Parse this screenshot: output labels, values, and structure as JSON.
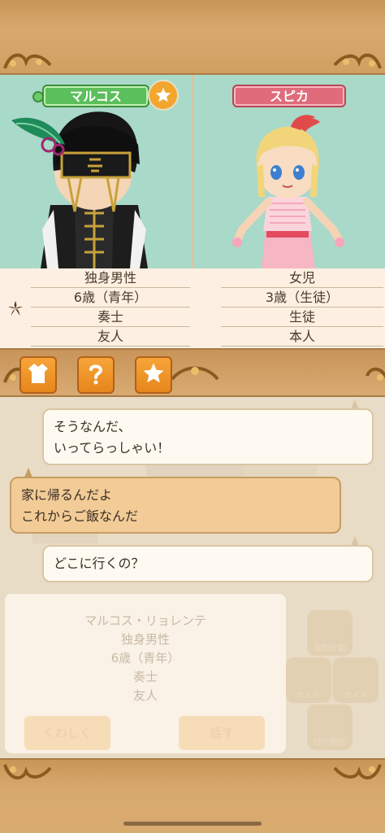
{
  "characters": {
    "left": {
      "name": "マルコス",
      "info": [
        "独身男性",
        "6歳（青年）",
        "奏士",
        "友人"
      ]
    },
    "right": {
      "name": "スピカ",
      "info": [
        "女児",
        "3歳（生徒）",
        "生徒",
        "本人"
      ]
    }
  },
  "toolbar": {
    "icons": [
      "clothes-icon",
      "question-icon",
      "star-icon"
    ]
  },
  "chat": [
    {
      "side": "right",
      "lines": [
        "そうなんだ、",
        "いってらっしゃい！"
      ]
    },
    {
      "side": "left",
      "lines": [
        "家に帰るんだよ",
        "これからご飯なんだ"
      ]
    },
    {
      "side": "right",
      "lines": [
        "どこに行くの？"
      ]
    }
  ],
  "background_card": {
    "full_name": "マルコス・リョレンテ",
    "info": [
      "独身男性",
      "6歳（青年）",
      "奏士",
      "友人"
    ],
    "details_button": "くわしく",
    "talk_button": "話す"
  },
  "side_menu": [
    "自動行動",
    "かんり",
    "ガイド",
    "日付関係"
  ],
  "colors": {
    "frame": "#d7a96e",
    "portrait_bg": "#a9d9c9",
    "accent_orange": "#f3a62e"
  }
}
